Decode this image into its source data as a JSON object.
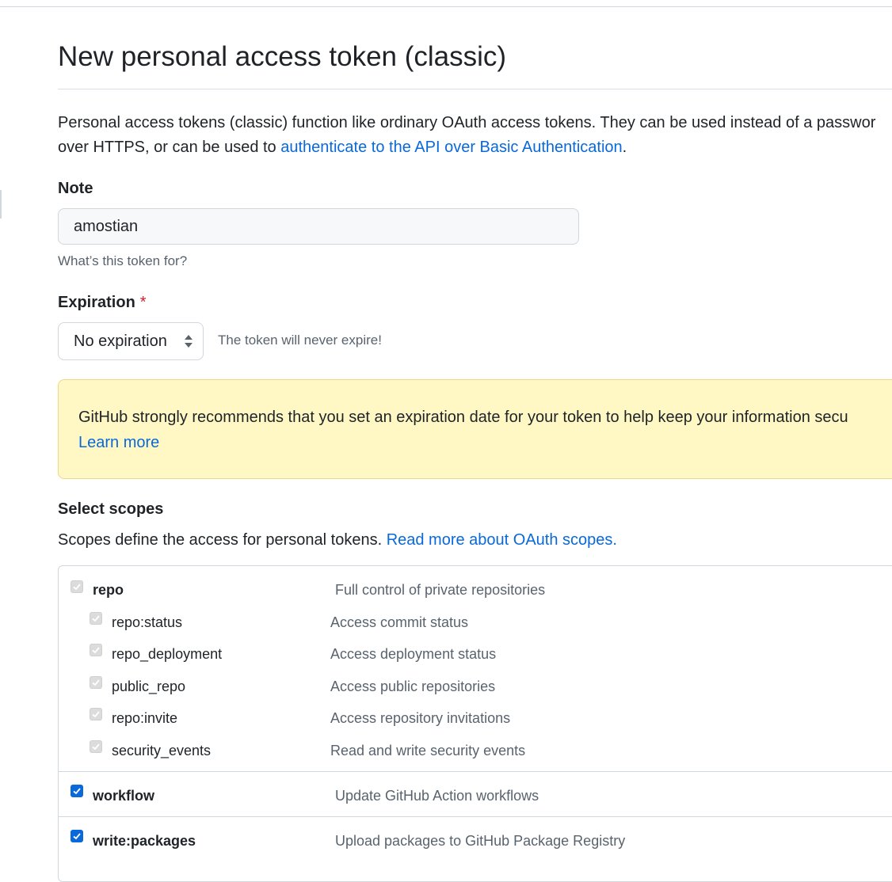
{
  "page": {
    "title": "New personal access token (classic)"
  },
  "intro": {
    "text_before": "Personal access tokens (classic) function like ordinary OAuth access tokens. They can be used instead of a passwor",
    "text_line2": "over HTTPS, or can be used to ",
    "link": "authenticate to the API over Basic Authentication",
    "text_after": "."
  },
  "note": {
    "label": "Note",
    "value": "amostian",
    "hint": "What’s this token for?"
  },
  "expiration": {
    "label": "Expiration",
    "required_mark": "*",
    "selected": "No expiration",
    "hint": "The token will never expire!"
  },
  "warning": {
    "text": "GitHub strongly recommends that you set an expiration date for your token to help keep your information secu",
    "link": "Learn more",
    "color": "#fff8c5"
  },
  "scopes": {
    "heading": "Select scopes",
    "description": "Scopes define the access for personal tokens. ",
    "description_link": "Read more about OAuth scopes.",
    "items": [
      {
        "name": "repo",
        "desc": "Full control of private repositories",
        "state": "disabled-checked"
      },
      {
        "name": "repo:status",
        "desc": "Access commit status",
        "state": "disabled-checked"
      },
      {
        "name": "repo_deployment",
        "desc": "Access deployment status",
        "state": "disabled-checked"
      },
      {
        "name": "public_repo",
        "desc": "Access public repositories",
        "state": "disabled-checked"
      },
      {
        "name": "repo:invite",
        "desc": "Access repository invitations",
        "state": "disabled-checked"
      },
      {
        "name": "security_events",
        "desc": "Read and write security events",
        "state": "disabled-checked"
      },
      {
        "name": "workflow",
        "desc": "Update GitHub Action workflows",
        "state": "checked"
      },
      {
        "name": "write:packages",
        "desc": "Upload packages to GitHub Package Registry",
        "state": "checked"
      }
    ]
  },
  "colors": {
    "link": "#0969da",
    "checkbox_checked": "#0969da",
    "required": "#cf222e"
  }
}
